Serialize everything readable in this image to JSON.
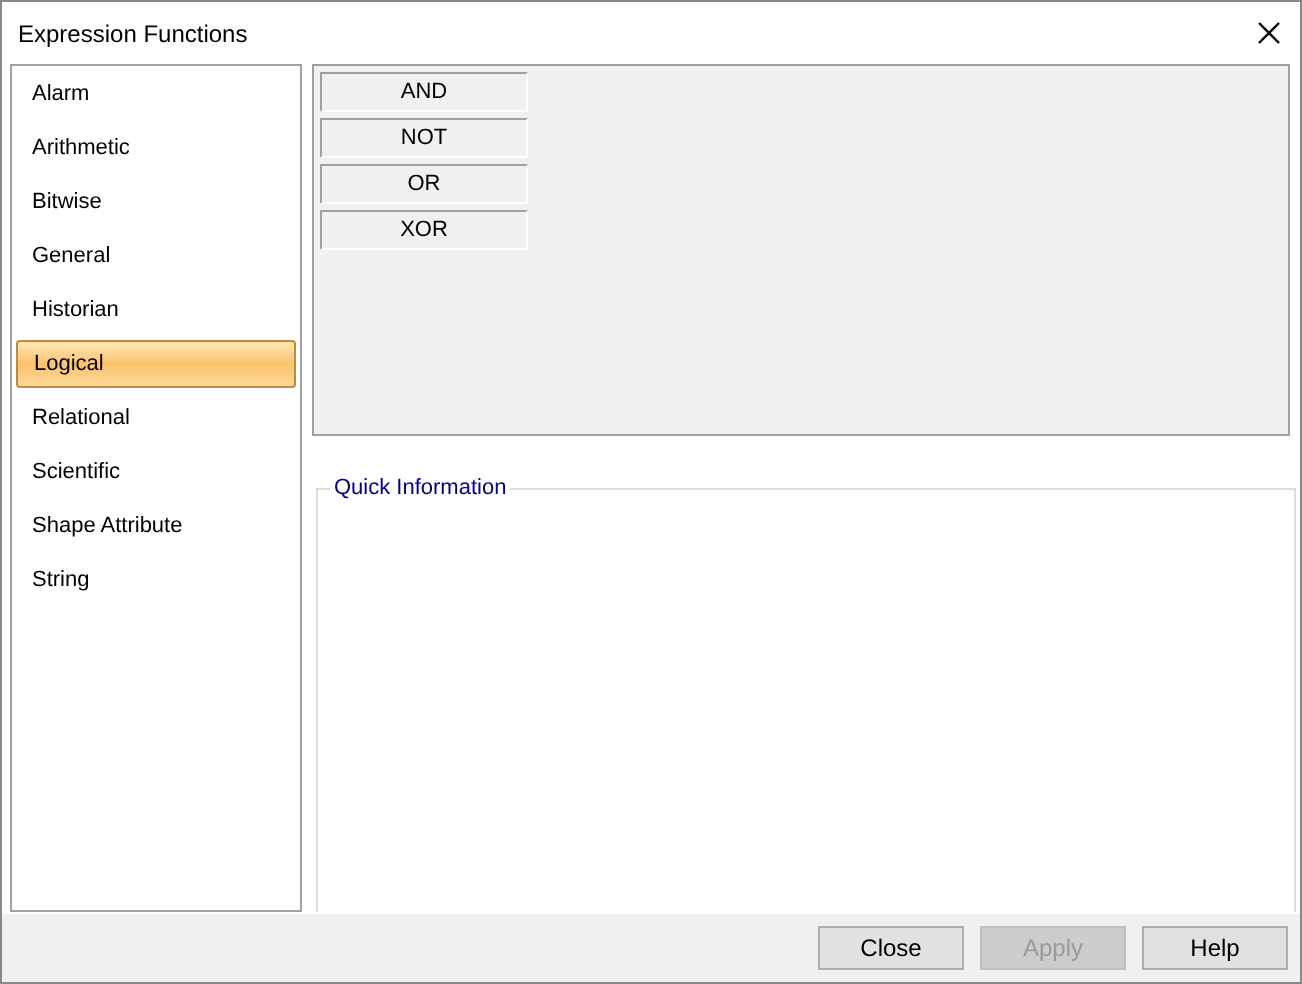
{
  "window": {
    "title": "Expression Functions"
  },
  "categories": [
    {
      "label": "Alarm",
      "selected": false
    },
    {
      "label": "Arithmetic",
      "selected": false
    },
    {
      "label": "Bitwise",
      "selected": false
    },
    {
      "label": "General",
      "selected": false
    },
    {
      "label": "Historian",
      "selected": false
    },
    {
      "label": "Logical",
      "selected": true
    },
    {
      "label": "Relational",
      "selected": false
    },
    {
      "label": "Scientific",
      "selected": false
    },
    {
      "label": "Shape Attribute",
      "selected": false
    },
    {
      "label": "String",
      "selected": false
    }
  ],
  "functions": [
    "AND",
    "NOT",
    "OR",
    "XOR"
  ],
  "quick_information": {
    "title": "Quick Information"
  },
  "buttons": [
    {
      "label": "Close",
      "disabled": false
    },
    {
      "label": "Apply",
      "disabled": true
    },
    {
      "label": "Help",
      "disabled": false
    }
  ]
}
